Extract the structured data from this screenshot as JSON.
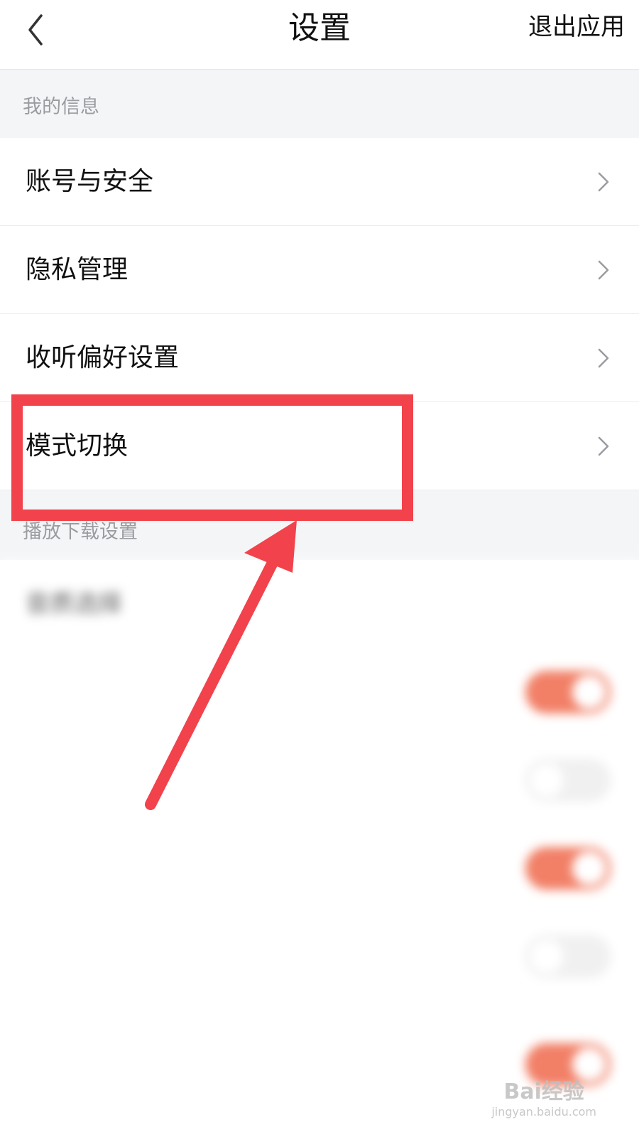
{
  "header": {
    "title": "设置",
    "exit_label": "退出应用"
  },
  "sections": [
    {
      "title": "我的信息"
    },
    {
      "title": "播放下载设置"
    }
  ],
  "info_items": [
    {
      "label": "账号与安全"
    },
    {
      "label": "隐私管理"
    },
    {
      "label": "收听偏好设置"
    },
    {
      "label": "模式切换"
    }
  ],
  "playback_items": [
    {
      "label": "音质选择"
    }
  ],
  "colors": {
    "annotation": "#f2424b",
    "toggle_on": "#f06a4d"
  },
  "watermark": {
    "brand": "Bai经验",
    "url": "jingyan.baidu.com"
  }
}
